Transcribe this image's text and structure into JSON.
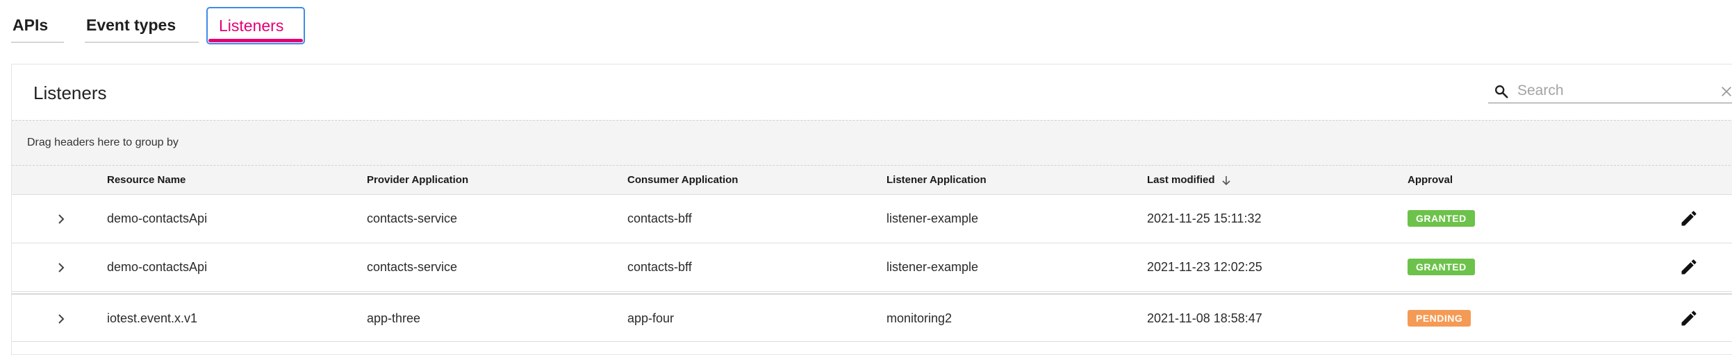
{
  "tabs": [
    {
      "label": "APIs"
    },
    {
      "label": "Event types"
    },
    {
      "label": "Listeners"
    }
  ],
  "panel": {
    "title": "Listeners",
    "search": {
      "placeholder": "Search",
      "value": ""
    },
    "group_hint": "Drag headers here to group by"
  },
  "columns": [
    "Resource Name",
    "Provider Application",
    "Consumer Application",
    "Listener Application",
    "Last modified",
    "Approval"
  ],
  "rows": [
    {
      "resource": "demo-contactsApi",
      "provider": "contacts-service",
      "consumer": "contacts-bff",
      "listener": "listener-example",
      "modified": "2021-11-25 15:11:32",
      "approval": "GRANTED"
    },
    {
      "resource": "demo-contactsApi",
      "provider": "contacts-service",
      "consumer": "contacts-bff",
      "listener": "listener-example",
      "modified": "2021-11-23 12:02:25",
      "approval": "GRANTED"
    },
    {
      "resource": "iotest.event.x.v1",
      "provider": "app-three",
      "consumer": "app-four",
      "listener": "monitoring2",
      "modified": "2021-11-08 18:58:47",
      "approval": "PENDING"
    }
  ],
  "colors": {
    "accent": "#e20074",
    "focus": "#3d8be8",
    "granted": "#6cc24a",
    "pending": "#f59a54"
  },
  "icons": {
    "search": "search-icon",
    "clear": "close-icon",
    "sort": "arrow-down-icon",
    "expand": "chevron-right-icon",
    "edit": "pencil-icon"
  }
}
